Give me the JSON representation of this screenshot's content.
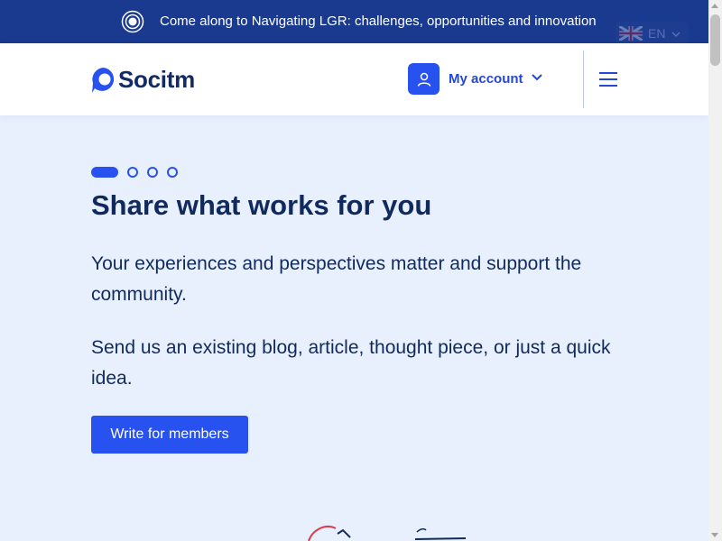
{
  "banner": {
    "text": "Come along to Navigating LGR: challenges, opportunities and innovation",
    "icon": "broadcast-icon",
    "language": "EN"
  },
  "header": {
    "logo_text": "Socitm",
    "account_label": "My account",
    "account_icon": "user-icon",
    "menu_icon": "hamburger-icon"
  },
  "carousel": {
    "slide_count": 4,
    "active_index": 0
  },
  "hero": {
    "title": "Share what works for you",
    "paragraph1": "Your experiences and perspectives matter and support the community.",
    "paragraph2": "Send us an existing blog, article, thought piece, or just a quick idea.",
    "cta_label": "Write for members"
  },
  "colors": {
    "banner_bg": "#1a3a8f",
    "accent": "#2752f0",
    "page_bg": "#e8f0fd",
    "heading": "#112a5e"
  }
}
